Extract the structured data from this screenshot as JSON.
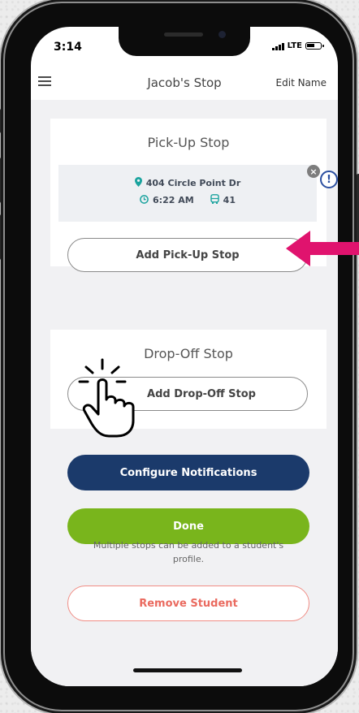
{
  "status": {
    "time": "3:14",
    "network": "LTE"
  },
  "nav": {
    "title": "Jacob's Stop",
    "edit": "Edit Name",
    "menu_icon": "hamburger-menu-icon"
  },
  "pickup": {
    "title": "Pick-Up Stop",
    "address": "404 Circle Point Dr",
    "time": "6:22 AM",
    "bus": "41",
    "add_button": "Add Pick-Up Stop"
  },
  "dropoff": {
    "title": "Drop-Off Stop",
    "add_button": "Add Drop-Off Stop"
  },
  "buttons": {
    "configure": "Configure Notifications",
    "done": "Done",
    "remove": "Remove Student"
  },
  "note": "Multiple stops can be added to a student's profile.",
  "colors": {
    "configure_bg": "#1b3a6b",
    "done_bg": "#79b51c",
    "remove_border": "#f08d85",
    "accent_teal": "#1aa39e",
    "arrow": "#e0136e"
  },
  "icons": [
    "location-pin-icon",
    "clock-icon",
    "bus-icon",
    "close-icon",
    "info-icon",
    "pointer-hand-icon",
    "arrow-left-icon"
  ]
}
